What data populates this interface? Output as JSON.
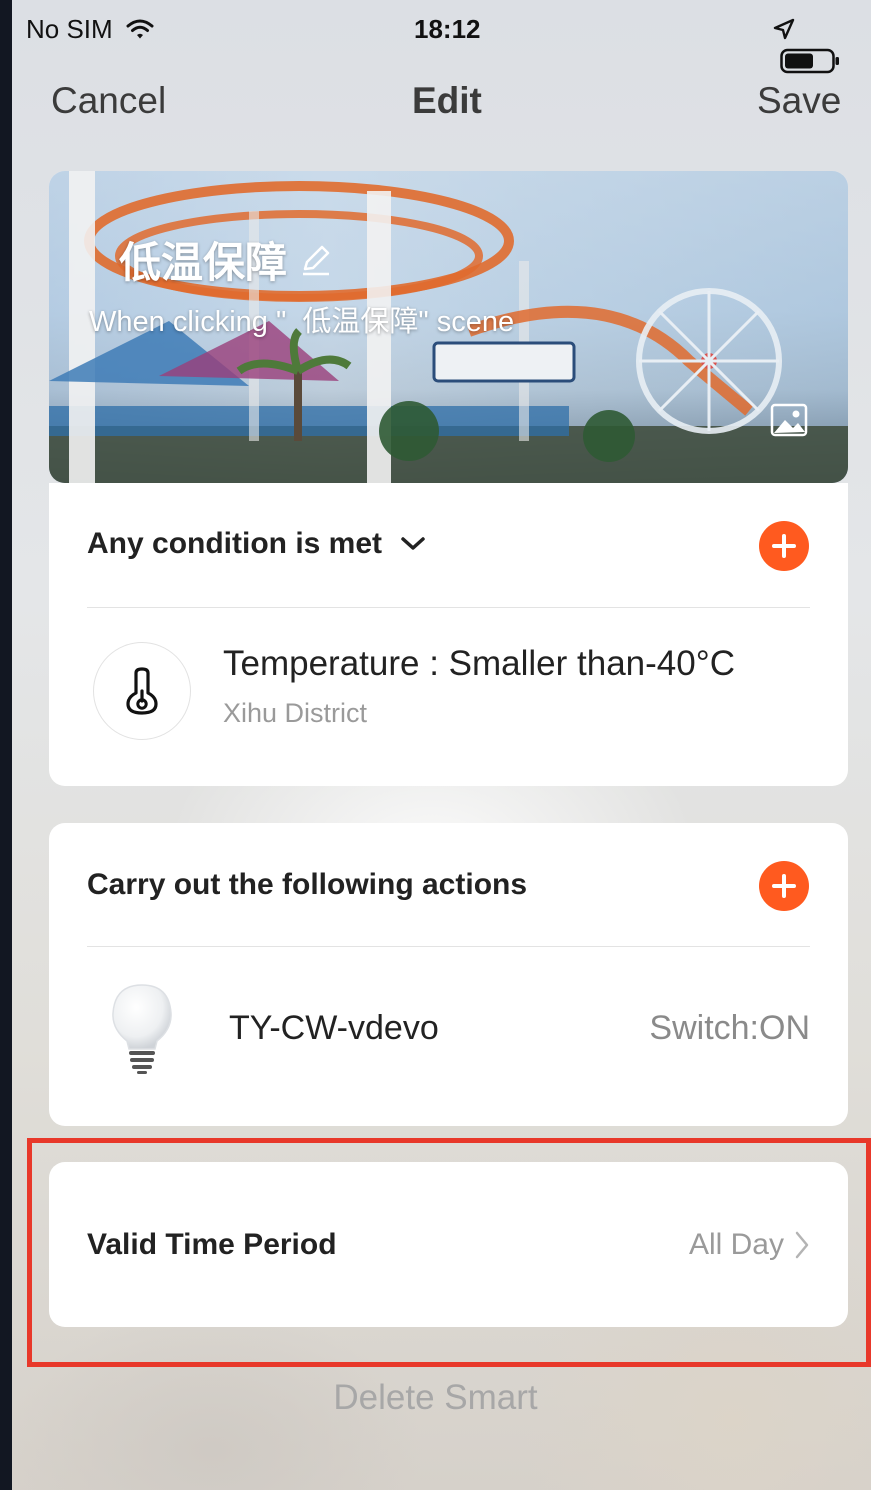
{
  "status_bar": {
    "carrier": "No SIM",
    "time": "18:12"
  },
  "nav": {
    "cancel": "Cancel",
    "title": "Edit",
    "save": "Save"
  },
  "scene": {
    "name": "低温保障",
    "subtitle": "When clicking \"  低温保障\" scene"
  },
  "conditions": {
    "mode_label": "Any condition is met",
    "items": [
      {
        "title": "Temperature : Smaller than-40°C",
        "subtitle": "Xihu District",
        "icon": "thermometer-icon"
      }
    ]
  },
  "actions": {
    "header": "Carry out the following actions",
    "items": [
      {
        "device": "TY-CW-vdevo",
        "state": "Switch:ON",
        "icon": "light-bulb-icon"
      }
    ]
  },
  "valid_time": {
    "label": "Valid Time Period",
    "value": "All Day"
  },
  "delete_label": "Delete Smart",
  "colors": {
    "accent": "#ff5a1f",
    "highlight": "#e8382a"
  }
}
